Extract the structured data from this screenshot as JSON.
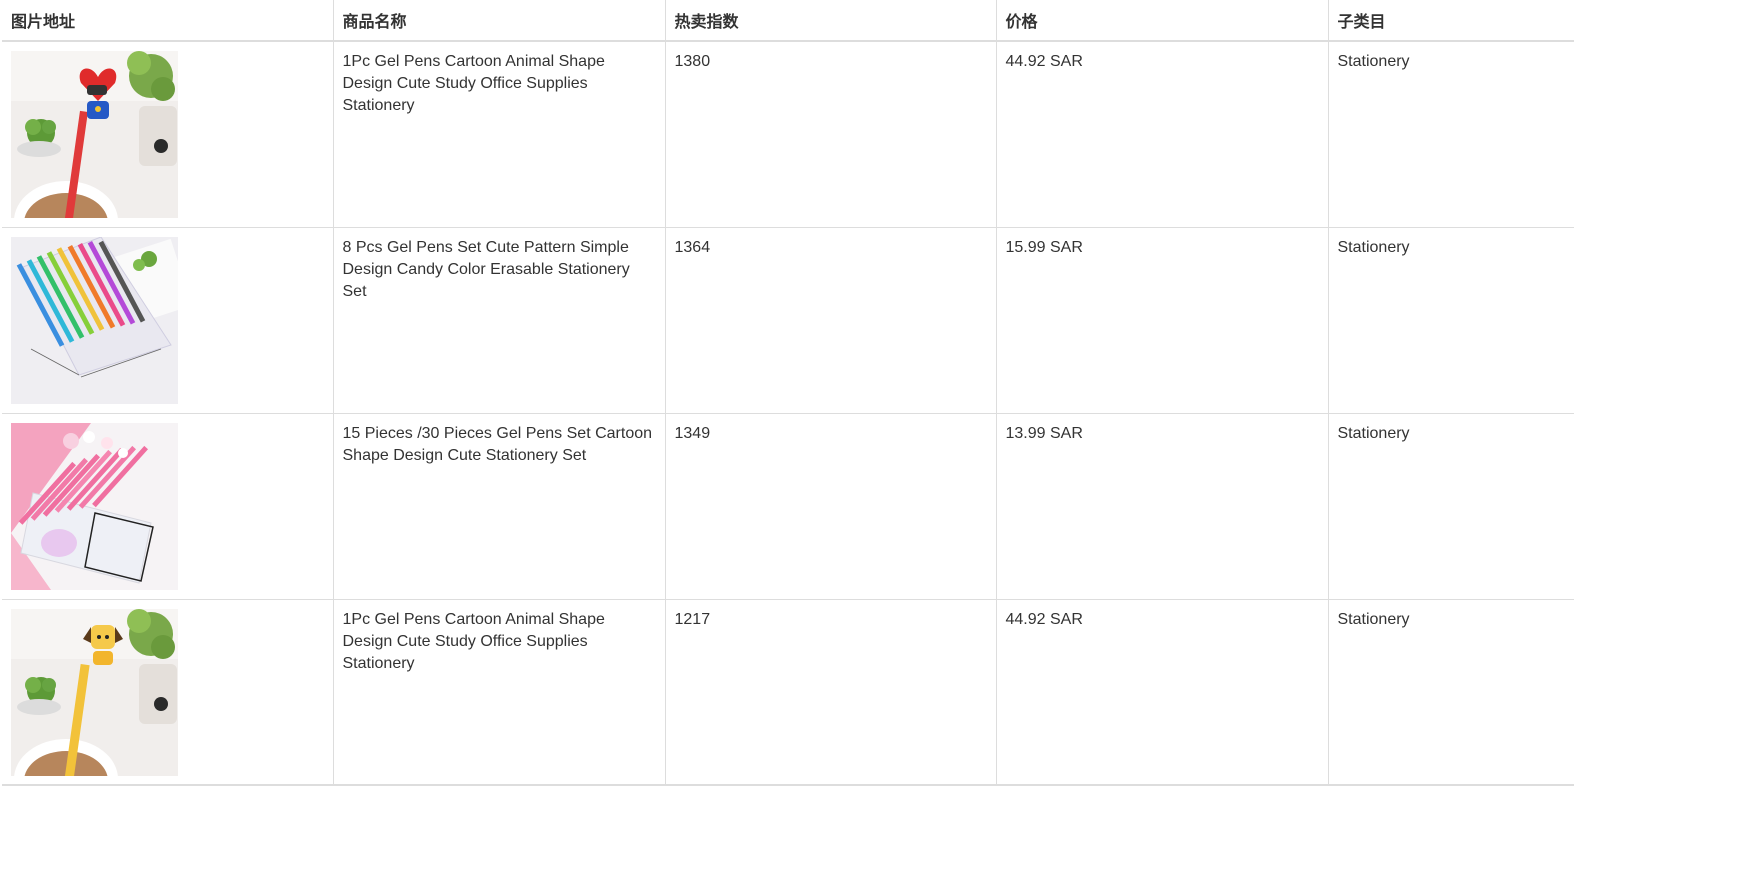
{
  "table": {
    "headers": [
      "图片地址",
      "商品名称",
      "热卖指数",
      "价格",
      "子类目"
    ],
    "rows": [
      {
        "image": "pen-red-heart-character-thumbnail",
        "name": "1Pc Gel Pens Cartoon Animal Shape Design Cute Study Office Supplies Stationery",
        "hot": "1380",
        "price": "44.92 SAR",
        "category": "Stationery"
      },
      {
        "image": "gel-pens-8-colors-set-thumbnail",
        "name": "8 Pcs Gel Pens Set Cute Pattern Simple Design Candy Color Erasable Stationery Set",
        "hot": "1364",
        "price": "15.99 SAR",
        "category": "Stationery"
      },
      {
        "image": "pink-gel-pens-unicorn-bag-thumbnail",
        "name": "15 Pieces /30 Pieces Gel Pens Set Cartoon Shape Design Cute Stationery Set",
        "hot": "1349",
        "price": "13.99 SAR",
        "category": "Stationery"
      },
      {
        "image": "pen-yellow-dog-character-thumbnail",
        "name": "1Pc Gel Pens Cartoon Animal Shape Design Cute Study Office Supplies Stationery",
        "hot": "1217",
        "price": "44.92 SAR",
        "category": "Stationery"
      }
    ]
  }
}
